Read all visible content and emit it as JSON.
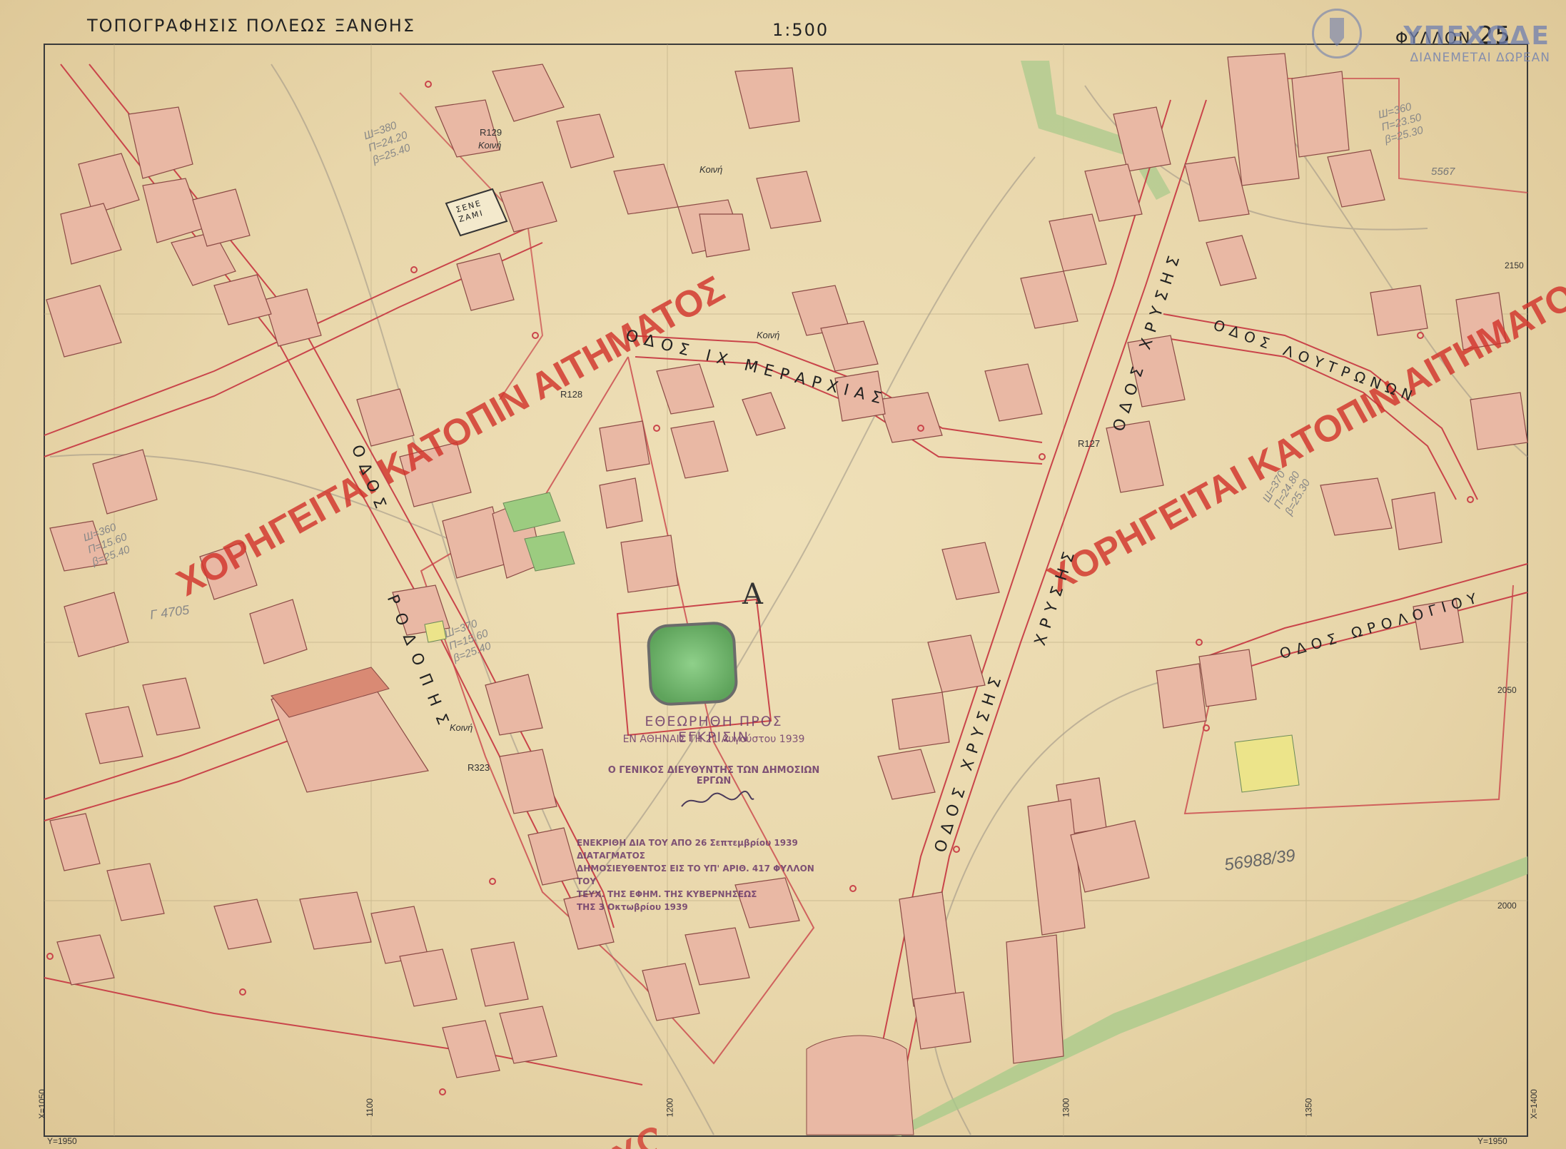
{
  "header": {
    "title": "ΤΟΠΟΓΡΑΦΗΣΙΣ ΠΟΛΕΩΣ ΞΑΝΘΗΣ",
    "scale": "1:500",
    "sheet_label": "ΦΥΛΛΟΝ",
    "sheet_number": "25"
  },
  "agency": {
    "name": "ΥΠΕΧΩΔΕ",
    "tagline": "ΔΙΑΝΕΜΕΤΑΙ ΔΩΡΕΑΝ"
  },
  "watermark": {
    "text": "ΧΟΡΗΓΕΙΤΑΙ ΚΑΤΟΠΙΝ ΑΙΤΗΜΑΤΟΣ",
    "color": "#d2342c"
  },
  "streets": {
    "ix_merarchias": "ΟΔΟΣ ΙΧ ΜΕΡΑΡΧΙΑΣ",
    "chrysis_north": "ΟΔΟΣ ΧΡΥΣΗΣ",
    "chrysis_south": "ΟΔΟΣ ΧΡΥΣΗΣ",
    "chrysis_mid": "ΧΡΥΣΗΣ",
    "rodopis_upper": "ΟΔΟΣ",
    "rodopis_lower": "ΡΟΔΟΠΗΣ",
    "loutronon": "ΟΔΟΣ ΛΟΥΤΡΩΝΩΝ",
    "orologiou": "ΟΔΟΣ ΩΡΟΛΟΓΙΟΥ"
  },
  "labels": {
    "sene_zami": "ΣΕΝΕ ΖΑΜΙ",
    "area_a": "Α",
    "koini_1": "Κοινή",
    "koini_2": "Κοινή",
    "koini_3": "Κοινή",
    "koini_4": "Κοινή",
    "r129": "R129",
    "r128": "R128",
    "r127": "R127",
    "r323": "R323",
    "note_5567": "5567",
    "note_56988": "56988/39",
    "note_4705": "Γ 4705"
  },
  "grid_labels": {
    "top_2150": "2150",
    "right_2050": "2050",
    "right_2000": "2000",
    "bottom_1100": "1100",
    "bottom_1200": "1200",
    "bottom_1300": "1300",
    "bottom_1350": "1350",
    "corner_bl_x": "X=1050",
    "corner_bl_y": "Y=1950",
    "corner_br_x": "X=1400",
    "corner_br_y": "Y=1950"
  },
  "stamps": {
    "submission": "ΕΘΕΩΡΗΘΗ ΠΡΟΣ ΕΓΚΡΙΣΙΝ",
    "athens_date": "ΕΝ ΑΘΗΝΑΙΣ ΤΗ 21 Αυγούστου 1939",
    "director": "Ο ΓΕΝΙΚΟΣ ΔΙΕΥΘΥΝΤΗΣ ΤΩΝ ΔΗΜΟΣΙΩΝ ΕΡΓΩΝ",
    "approval_1": "ΕΝΕΚΡΙΘΗ ΔΙΑ ΤΟΥ ΑΠΟ 26 Σεπτεμβρίου 1939 ΔΙΑΤΑΓΜΑΤΟΣ",
    "approval_2": "ΔΗΜΟΣΙΕΥΘΕΝΤΟΣ ΕΙΣ ΤΟ ΥΠ' ΑΡΙΘ. 417 ΦΥΛΛΟΝ ΤΟΥ",
    "approval_3": "ΤΕΥΧ. ΤΗΣ ΕΦΗΜ. ΤΗΣ ΚΥΒΕΡΝΗΣΕΩΣ",
    "approval_4": "ΤΗΣ 3 Οκτωβρίου 1939"
  },
  "annotations": {
    "ann_left_1": "Ш=360",
    "ann_left_2": "Π=15.60",
    "ann_left_3": "β=25.40",
    "ann_top_1": "Ш=380",
    "ann_top_2": "Π=24.20",
    "ann_top_3": "β=25.40",
    "ann_right_1": "Ш=360",
    "ann_right_2": "Π=23.50",
    "ann_right_3": "β=25.30",
    "ann_ctr_1": "Ш=370",
    "ann_ctr_2": "Π=15.60",
    "ann_ctr_3": "β=25.40",
    "ann_e_1": "Ш=370",
    "ann_e_2": "Π=24.80",
    "ann_e_3": "β=25.30"
  },
  "colors": {
    "paper": "#e8d6aa",
    "building_fill": "#e9b8a4",
    "parcel_line": "#c9444a",
    "garden": "#8fc27a",
    "stream": "#a6c98a",
    "stamp": "#6c3a6b"
  }
}
